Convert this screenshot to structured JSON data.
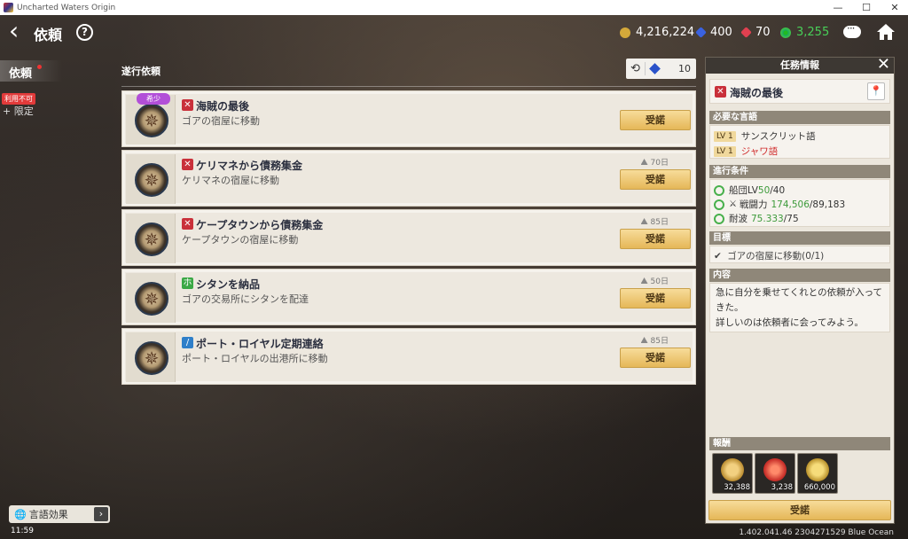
{
  "window": {
    "title": "Uncharted Waters Origin"
  },
  "header": {
    "title": "依頼",
    "currencies": [
      {
        "icon": "gold-coin-icon",
        "value": "4,216,224",
        "color": "#d4a93a"
      },
      {
        "icon": "sapphire-icon",
        "value": "400",
        "color": "#3a62e0"
      },
      {
        "icon": "ruby-icon",
        "value": "70",
        "color": "#e04050"
      },
      {
        "icon": "helm-wheel-icon",
        "value": "3,255",
        "color": "#3ec04a"
      }
    ]
  },
  "sidebar": {
    "tab_label": "依頼",
    "unavailable_badge": "利用不可",
    "limited_label": "+ 限定",
    "lang_effect_label": "言語効果"
  },
  "status": {
    "clock": "11:59",
    "version": "1.402.041.46 2304271529 Blue Ocean"
  },
  "list": {
    "section_title": "遂行依頼",
    "refresh_cost": "10",
    "accept_label": "受諾",
    "quests": [
      {
        "name": "海賊の最後",
        "desc": "ゴアの宿屋に移動",
        "days": "",
        "rare": "希少",
        "type_color": "#c9303a",
        "type_glyph": "✕"
      },
      {
        "name": "ケリマネから債務集金",
        "desc": "ケリマネの宿屋に移動",
        "days": "70日",
        "rare": "",
        "type_color": "#c9303a",
        "type_glyph": "✕"
      },
      {
        "name": "ケープタウンから債務集金",
        "desc": "ケープタウンの宿屋に移動",
        "days": "85日",
        "rare": "",
        "type_color": "#c9303a",
        "type_glyph": "✕"
      },
      {
        "name": "シタンを納品",
        "desc": "ゴアの交易所にシタンを配達",
        "days": "50日",
        "rare": "",
        "type_color": "#3aa845",
        "type_glyph": "ホ"
      },
      {
        "name": "ポート・ロイヤル定期連絡",
        "desc": "ポート・ロイヤルの出港所に移動",
        "days": "85日",
        "rare": "",
        "type_color": "#2f7fc9",
        "type_glyph": "/"
      }
    ]
  },
  "panel": {
    "title": "任務情報",
    "quest_name": "海賊の最後",
    "lang_title": "必要な言語",
    "langs": [
      {
        "lv": "LV 1",
        "name": "サンスクリット語",
        "missing": false
      },
      {
        "lv": "LV 1",
        "name": "ジャワ語",
        "missing": true
      }
    ],
    "cond_title": "進行条件",
    "conds": {
      "fleet_label": "船団LV",
      "fleet_cur": "50",
      "fleet_req": "/40",
      "power_label": "戦闘力",
      "power_cur": "174,506",
      "power_req": "/89,183",
      "wave_label": "耐波",
      "wave_cur": "75.333",
      "wave_req": "/75"
    },
    "goal_title": "目標",
    "goal_text": "ゴアの宿屋に移動(0/1)",
    "content_title": "内容",
    "content_text_1": "急に自分を乗せてくれとの依頼が入って",
    "content_text_2": "きた。",
    "content_text_3": "詳しいのは依頼者に会ってみよう。",
    "reward_title": "報酬",
    "rewards": [
      {
        "icon": "medal-icon",
        "amount": "32,388"
      },
      {
        "icon": "star-badge-icon",
        "amount": "3,238"
      },
      {
        "icon": "gold-coin-icon",
        "amount": "660,000"
      }
    ],
    "accept_label": "受諾"
  }
}
